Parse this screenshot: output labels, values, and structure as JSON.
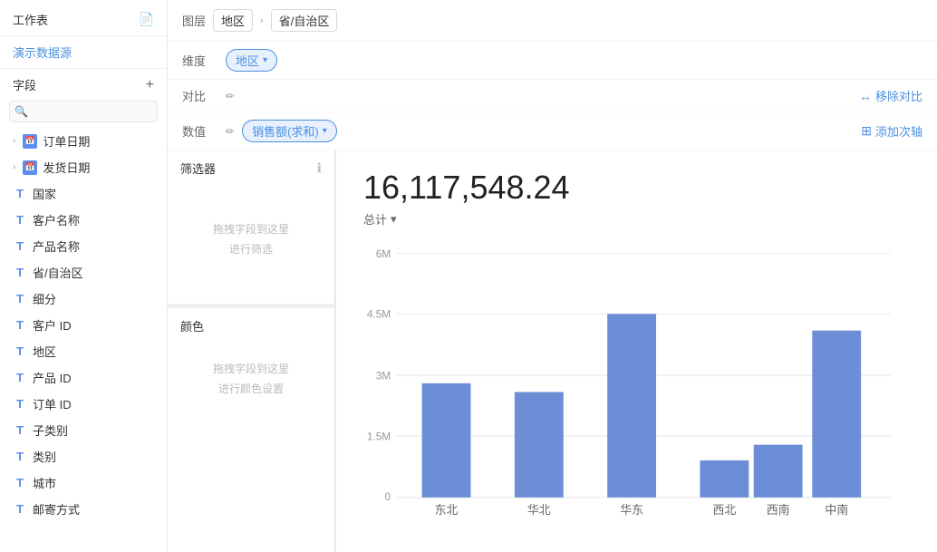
{
  "sidebar": {
    "title": "工作表",
    "datasource": "演示数据源",
    "fields_label": "字段",
    "search_placeholder": "",
    "field_groups": [
      {
        "type": "date",
        "icon": "date",
        "label": "订单日期",
        "expanded": false
      },
      {
        "type": "date",
        "icon": "date",
        "label": "发货日期",
        "expanded": false
      },
      {
        "type": "text",
        "icon": "T",
        "label": "国家"
      },
      {
        "type": "text",
        "icon": "T",
        "label": "客户名称"
      },
      {
        "type": "text",
        "icon": "T",
        "label": "产品名称"
      },
      {
        "type": "text",
        "icon": "T",
        "label": "省/自治区"
      },
      {
        "type": "text",
        "icon": "T",
        "label": "细分"
      },
      {
        "type": "text",
        "icon": "T",
        "label": "客户 ID"
      },
      {
        "type": "text",
        "icon": "T",
        "label": "地区"
      },
      {
        "type": "text",
        "icon": "T",
        "label": "产品 ID"
      },
      {
        "type": "text",
        "icon": "T",
        "label": "订单 ID"
      },
      {
        "type": "text",
        "icon": "T",
        "label": "子类别"
      },
      {
        "type": "text",
        "icon": "T",
        "label": "类别"
      },
      {
        "type": "text",
        "icon": "T",
        "label": "城市"
      },
      {
        "type": "text",
        "icon": "T",
        "label": "邮寄方式"
      }
    ]
  },
  "toolbar": {
    "layer_label": "图层",
    "breadcrumb_first": "地区",
    "breadcrumb_last": "省/自治区"
  },
  "dimension_row": {
    "label": "维度",
    "tag": "地区",
    "caret": "▾"
  },
  "compare_row": {
    "label": "对比",
    "right_label": "移除对比",
    "right_icon": "↔"
  },
  "value_row": {
    "label": "数值",
    "tag": "销售额(求和)",
    "caret": "▾",
    "right_label": "添加次轴",
    "right_icon": "⊞"
  },
  "filter_section": {
    "label": "筛选器",
    "drop_text_line1": "拖拽字段到这里",
    "drop_text_line2": "进行筛选"
  },
  "color_section": {
    "label": "颜色",
    "drop_text_line1": "拖拽字段到这里",
    "drop_text_line2": "进行颜色设置"
  },
  "chart": {
    "total": "16,117,548.24",
    "subtitle": "总计",
    "y_labels": [
      "6M",
      "4.5M",
      "3M",
      "1.5M",
      "0"
    ],
    "bars": [
      {
        "label": "东北",
        "value": 2800000
      },
      {
        "label": "华北",
        "value": 2600000
      },
      {
        "label": "华东",
        "value": 4500000
      },
      {
        "label": "西北",
        "value": 900000
      },
      {
        "label": "西南",
        "value": 1300000
      },
      {
        "label": "中南",
        "value": 4100000
      }
    ],
    "max_value": 6000000,
    "bar_color": "#6b8ed6"
  },
  "icons": {
    "search": "🔍",
    "add": "+",
    "edit": "✏",
    "info": "ℹ",
    "remove_compare": "↔",
    "add_axis": "⊞",
    "chevron_right": "›",
    "chevron_down": "▾",
    "cursor": "↗"
  }
}
